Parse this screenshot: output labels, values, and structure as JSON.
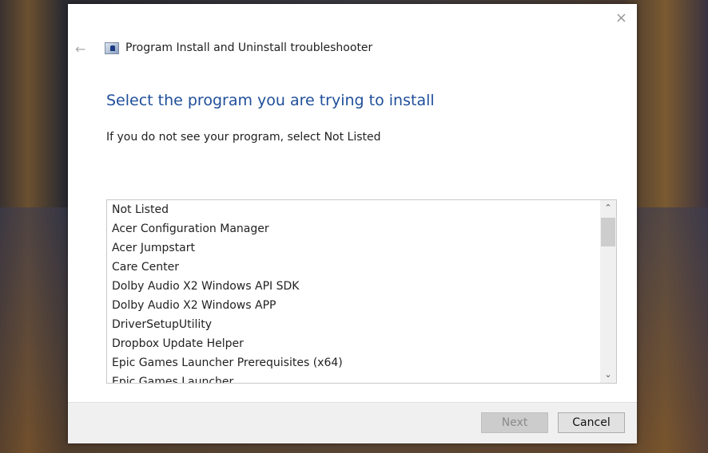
{
  "window": {
    "title": "Program Install and Uninstall troubleshooter",
    "close_icon": "×",
    "back_icon": "←"
  },
  "main": {
    "heading": "Select the program you are trying to install",
    "instruction": "If you do not see your program, select Not Listed",
    "programs": [
      "Not Listed",
      "Acer Configuration Manager",
      "Acer Jumpstart",
      "Care Center",
      "Dolby Audio X2 Windows API SDK",
      "Dolby Audio X2 Windows APP",
      "DriverSetupUtility",
      "Dropbox Update Helper",
      "Epic Games Launcher Prerequisites (x64)",
      "Epic Games Launcher"
    ],
    "scroll_up": "⌃",
    "scroll_down": "⌄"
  },
  "footer": {
    "next_label": "Next",
    "cancel_label": "Cancel"
  }
}
